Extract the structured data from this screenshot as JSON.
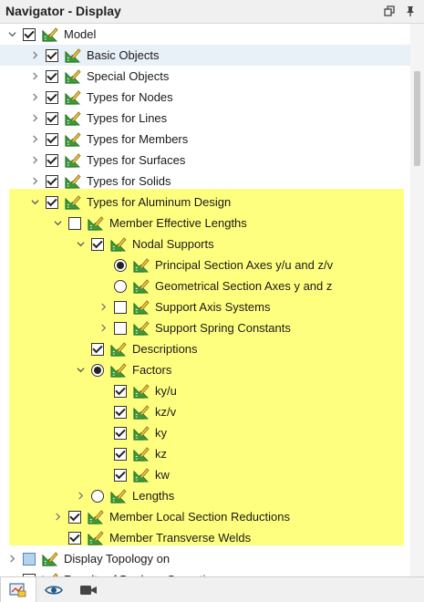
{
  "window": {
    "title": "Navigator - Display",
    "restore_icon": "restore-icon",
    "pin_icon": "pin-icon"
  },
  "colors": {
    "highlight": "#ffff7f",
    "selected_row": "#e8f0f8",
    "icon_green": "#3a9b3a",
    "icon_yellow": "#e8c54a"
  },
  "tree": [
    {
      "label": "Model",
      "level": 0,
      "arrow": "down",
      "control": "check",
      "state": "checked"
    },
    {
      "label": "Basic Objects",
      "level": 1,
      "arrow": "right",
      "control": "check",
      "state": "checked",
      "selected": true
    },
    {
      "label": "Special Objects",
      "level": 1,
      "arrow": "right",
      "control": "check",
      "state": "checked"
    },
    {
      "label": "Types for Nodes",
      "level": 1,
      "arrow": "right",
      "control": "check",
      "state": "checked"
    },
    {
      "label": "Types for Lines",
      "level": 1,
      "arrow": "right",
      "control": "check",
      "state": "checked"
    },
    {
      "label": "Types for Members",
      "level": 1,
      "arrow": "right",
      "control": "check",
      "state": "checked"
    },
    {
      "label": "Types for Surfaces",
      "level": 1,
      "arrow": "right",
      "control": "check",
      "state": "checked"
    },
    {
      "label": "Types for Solids",
      "level": 1,
      "arrow": "right",
      "control": "check",
      "state": "checked"
    },
    {
      "label": "Types for Aluminum Design",
      "level": 1,
      "arrow": "down",
      "control": "check",
      "state": "checked"
    },
    {
      "label": "Member Effective Lengths",
      "level": 2,
      "arrow": "down",
      "control": "check",
      "state": "unchecked"
    },
    {
      "label": "Nodal Supports",
      "level": 3,
      "arrow": "down",
      "control": "check",
      "state": "checked"
    },
    {
      "label": "Principal Section Axes y/u and z/v",
      "level": 4,
      "arrow": "none",
      "control": "radio",
      "state": "on"
    },
    {
      "label": "Geometrical Section Axes y and z",
      "level": 4,
      "arrow": "none",
      "control": "radio",
      "state": "off"
    },
    {
      "label": "Support Axis Systems",
      "level": 4,
      "arrow": "right",
      "control": "check",
      "state": "unchecked"
    },
    {
      "label": "Support Spring Constants",
      "level": 4,
      "arrow": "right",
      "control": "check",
      "state": "unchecked"
    },
    {
      "label": "Descriptions",
      "level": 3,
      "arrow": "none",
      "control": "check",
      "state": "checked"
    },
    {
      "label": "Factors",
      "level": 3,
      "arrow": "down",
      "control": "radio",
      "state": "on"
    },
    {
      "label": "ky/u",
      "level": 4,
      "arrow": "none",
      "control": "check",
      "state": "checked"
    },
    {
      "label": "kz/v",
      "level": 4,
      "arrow": "none",
      "control": "check",
      "state": "checked"
    },
    {
      "label": "ky",
      "level": 4,
      "arrow": "none",
      "control": "check",
      "state": "checked"
    },
    {
      "label": "kz",
      "level": 4,
      "arrow": "none",
      "control": "check",
      "state": "checked"
    },
    {
      "label": "kw",
      "level": 4,
      "arrow": "none",
      "control": "check",
      "state": "checked"
    },
    {
      "label": "Lengths",
      "level": 3,
      "arrow": "right",
      "control": "radio",
      "state": "off"
    },
    {
      "label": "Member Local Section Reductions",
      "level": 2,
      "arrow": "right",
      "control": "check",
      "state": "checked"
    },
    {
      "label": "Member Transverse Welds",
      "level": 2,
      "arrow": "none",
      "control": "check",
      "state": "checked"
    },
    {
      "label": "Display Topology on",
      "level": 0,
      "arrow": "right",
      "control": "check",
      "state": "partial"
    },
    {
      "label": "Results of Boolean Operations",
      "level": 0,
      "arrow": "right",
      "control": "check",
      "state": "unchecked"
    }
  ],
  "bottom_tabs": [
    {
      "name": "data-tab",
      "icon": "data-navigator-icon",
      "active": true
    },
    {
      "name": "display-tab",
      "icon": "eye-icon",
      "active": false
    },
    {
      "name": "views-tab",
      "icon": "camera-icon",
      "active": false
    }
  ]
}
